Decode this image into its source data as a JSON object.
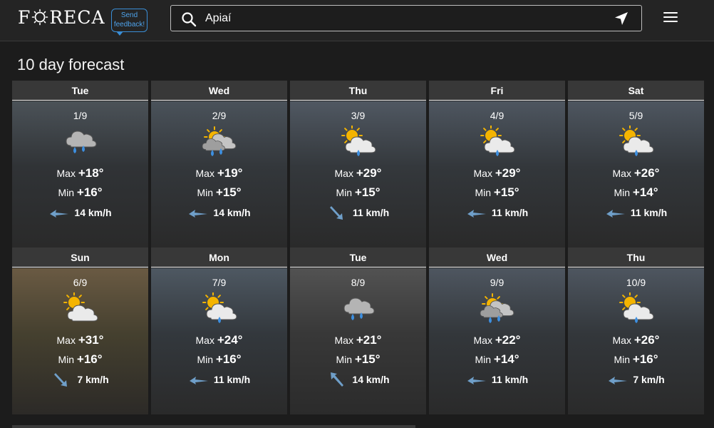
{
  "header": {
    "logo_pre": "F",
    "logo_post": "RECA",
    "feedback_line1": "Send",
    "feedback_line2": "feedback!",
    "search_value": "Apiaí"
  },
  "section_title": "10 day forecast",
  "labels": {
    "max": "Max",
    "min": "Min"
  },
  "colors": {
    "accent": "#3a8ed6",
    "sun": "#f4b400",
    "rain": "#3d8fe0"
  },
  "days": [
    {
      "dow": "Tue",
      "date": "1/9",
      "icon": "cloud-rain-icon",
      "max": "+18°",
      "min": "+16°",
      "wind": "14 km/h",
      "wind_dir": "left"
    },
    {
      "dow": "Wed",
      "date": "2/9",
      "icon": "partly-sunny-rain-icon",
      "max": "+19°",
      "min": "+15°",
      "wind": "14 km/h",
      "wind_dir": "left"
    },
    {
      "dow": "Thu",
      "date": "3/9",
      "icon": "sun-cloud-rain-icon",
      "max": "+29°",
      "min": "+15°",
      "wind": "11 km/h",
      "wind_dir": "down"
    },
    {
      "dow": "Fri",
      "date": "4/9",
      "icon": "sun-cloud-rain-icon",
      "max": "+29°",
      "min": "+15°",
      "wind": "11 km/h",
      "wind_dir": "left"
    },
    {
      "dow": "Sat",
      "date": "5/9",
      "icon": "sun-cloud-rain-icon",
      "max": "+26°",
      "min": "+14°",
      "wind": "11 km/h",
      "wind_dir": "left"
    },
    {
      "dow": "Sun",
      "date": "6/9",
      "icon": "sun-cloud-icon",
      "max": "+31°",
      "min": "+16°",
      "wind": "7 km/h",
      "wind_dir": "down"
    },
    {
      "dow": "Mon",
      "date": "7/9",
      "icon": "sun-cloud-rain-icon",
      "max": "+24°",
      "min": "+16°",
      "wind": "11 km/h",
      "wind_dir": "left"
    },
    {
      "dow": "Tue",
      "date": "8/9",
      "icon": "cloud-rain-icon",
      "max": "+21°",
      "min": "+15°",
      "wind": "14 km/h",
      "wind_dir": "up"
    },
    {
      "dow": "Wed",
      "date": "9/9",
      "icon": "partly-sunny-rain-icon",
      "max": "+22°",
      "min": "+14°",
      "wind": "11 km/h",
      "wind_dir": "left"
    },
    {
      "dow": "Thu",
      "date": "10/9",
      "icon": "sun-cloud-rain-icon",
      "max": "+26°",
      "min": "+16°",
      "wind": "7 km/h",
      "wind_dir": "left"
    }
  ]
}
